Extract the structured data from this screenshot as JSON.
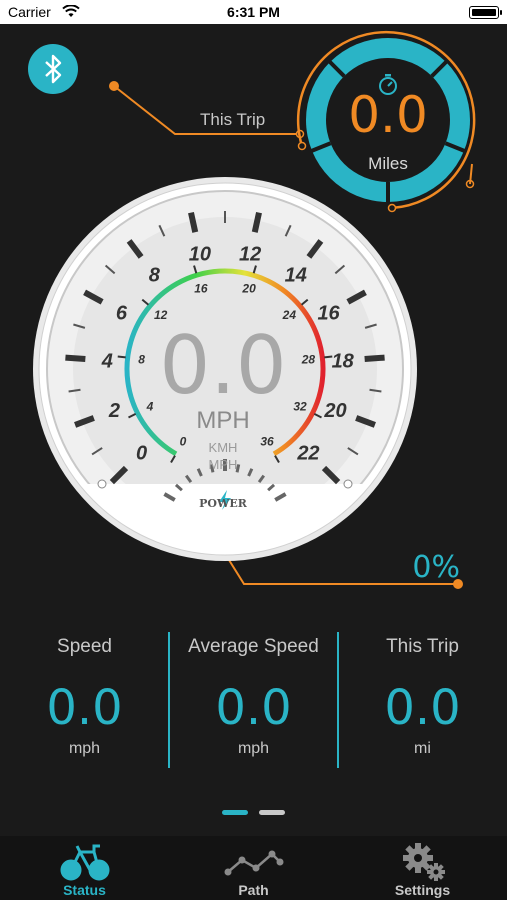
{
  "status_bar": {
    "carrier": "Carrier",
    "time": "6:31 PM",
    "wifi_icon": "wifi-icon",
    "battery_icon": "battery-full-icon"
  },
  "bluetooth": {
    "icon": "bluetooth-icon",
    "color": "#2ab4c6"
  },
  "trip_meter": {
    "label": "This Trip",
    "value": "0.0",
    "unit": "Miles",
    "icon": "stopwatch-icon",
    "value_color": "#f08a24",
    "ring_color": "#2ab4c6"
  },
  "gauge": {
    "speed_value": "0.0",
    "speed_unit": "MPH",
    "unit_options": [
      "KMH",
      "MPH"
    ],
    "mph_scale": [
      "0",
      "2",
      "4",
      "6",
      "8",
      "10",
      "12",
      "14",
      "16",
      "18",
      "20",
      "22"
    ],
    "kmh_scale": [
      "0",
      "4",
      "8",
      "12",
      "16",
      "20",
      "24",
      "28",
      "32",
      "36"
    ],
    "power_label": "POWER",
    "power_icon": "lightning-bolt-icon",
    "power_percent": "0%"
  },
  "stats": [
    {
      "label": "Speed",
      "value": "0.0",
      "unit": "mph"
    },
    {
      "label": "Average Speed",
      "value": "0.0",
      "unit": "mph"
    },
    {
      "label": "This Trip",
      "value": "0.0",
      "unit": "mi"
    }
  ],
  "pager": {
    "active_index": 0,
    "count": 2
  },
  "tabs": [
    {
      "label": "Status",
      "icon": "bicycle-icon",
      "active": true
    },
    {
      "label": "Path",
      "icon": "route-icon",
      "active": false
    },
    {
      "label": "Settings",
      "icon": "gears-icon",
      "active": false
    }
  ],
  "colors": {
    "accent": "#2ab4c6",
    "orange": "#f08a24",
    "background": "#1a1a1a",
    "tabbar": "#131313"
  }
}
